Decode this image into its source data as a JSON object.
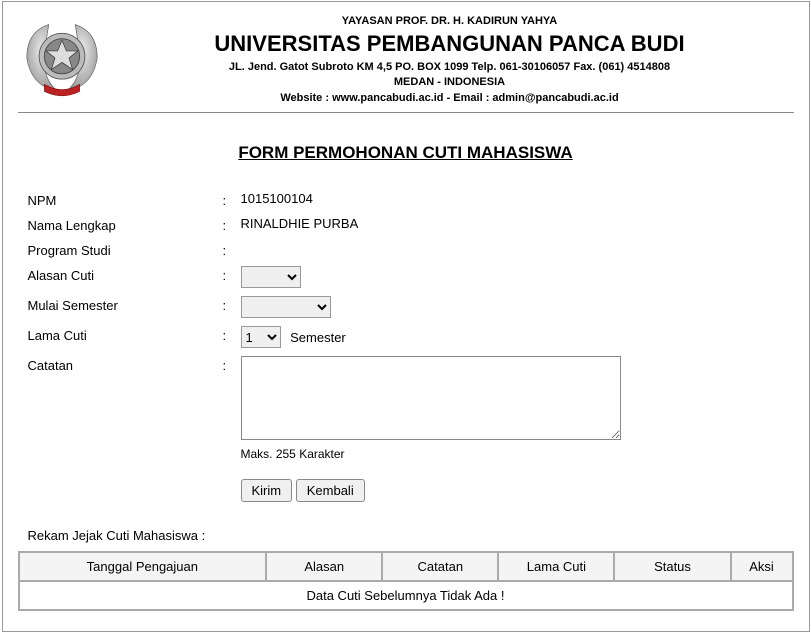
{
  "header": {
    "yayasan": "YAYASAN PROF. DR. H. KADIRUN YAHYA",
    "universitas": "UNIVERSITAS PEMBANGUNAN PANCA BUDI",
    "address1": "JL. Jend. Gatot Subroto KM 4,5 PO. BOX 1099 Telp. 061-30106057 Fax. (061) 4514808",
    "address2": "MEDAN - INDONESIA",
    "address3": "Website : www.pancabudi.ac.id - Email : admin@pancabudi.ac.id"
  },
  "form": {
    "title": "FORM PERMOHONAN CUTI MAHASISWA",
    "labels": {
      "npm": "NPM",
      "nama": "Nama Lengkap",
      "prodi": "Program Studi",
      "alasan": "Alasan Cuti",
      "mulai": "Mulai Semester",
      "lama": "Lama Cuti",
      "catatan": "Catatan"
    },
    "values": {
      "npm": "1015100104",
      "nama": "RINALDHIE PURBA",
      "prodi": "",
      "lama_selected": "1",
      "lama_unit": "Semester"
    },
    "note": "Maks. 255 Karakter",
    "buttons": {
      "kirim": "Kirim",
      "kembali": "Kembali"
    }
  },
  "history": {
    "title": "Rekam Jejak Cuti Mahasiswa :",
    "headers": {
      "tanggal": "Tanggal Pengajuan",
      "alasan": "Alasan",
      "catatan": "Catatan",
      "lama": "Lama Cuti",
      "status": "Status",
      "aksi": "Aksi"
    },
    "empty": "Data Cuti Sebelumnya Tidak Ada !"
  }
}
